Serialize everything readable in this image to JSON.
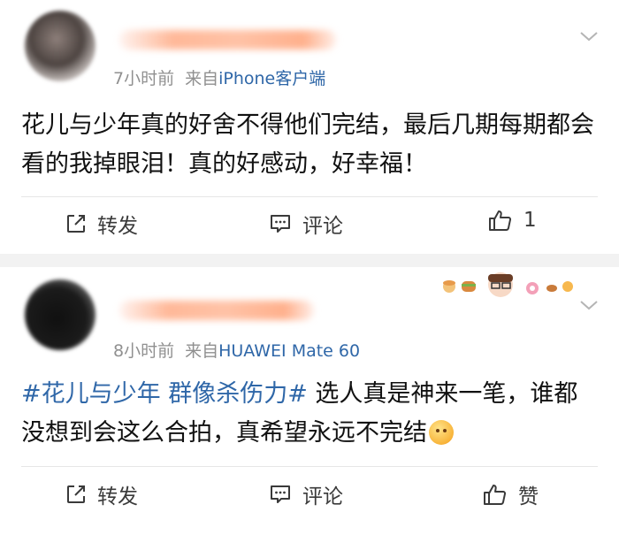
{
  "posts": [
    {
      "time": "7小时前",
      "source_prefix": "来自",
      "source": "iPhone客户端",
      "content": "花儿与少年真的好舍不得他们完结，最后几期每期都会看的我掉眼泪！真的好感动，好幸福！",
      "actions": {
        "repost": "转发",
        "comment": "评论",
        "like": "1"
      }
    },
    {
      "time": "8小时前",
      "source_prefix": "来自",
      "source": "HUAWEI Mate 60",
      "hashtag": "#花儿与少年 群像杀伤力#",
      "content": " 选人真是神来一笔，谁都没想到会这么合拍，真希望永远不完结",
      "actions": {
        "repost": "转发",
        "comment": "评论",
        "like": "赞"
      }
    }
  ],
  "colors": {
    "link": "#2f67a8",
    "meta": "#909090",
    "background": "#f2f2f2"
  }
}
